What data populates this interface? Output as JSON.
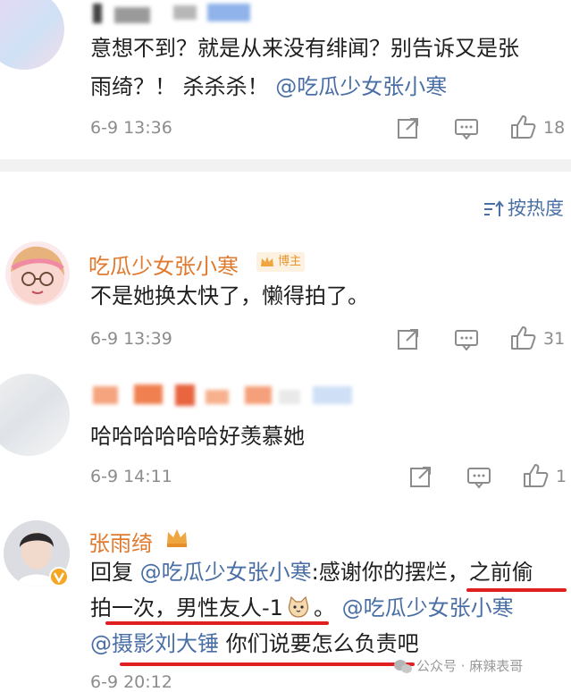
{
  "comment1": {
    "text_line1": "意想不到？就是从来没有绯闻？别告诉又是张",
    "text_line2_prefix": "雨绮？！ 杀杀杀！",
    "mention": "@吃瓜少女张小寒",
    "time": "6-9 13:36",
    "likes": "18"
  },
  "sort": {
    "label": "按热度"
  },
  "comment2": {
    "username": "吃瓜少女张小寒",
    "badge": "博主",
    "text": "不是她换太快了，懒得拍了。",
    "time": "6-9 13:39",
    "likes": "31"
  },
  "comment3": {
    "text": "哈哈哈哈哈哈好羡慕她",
    "time": "6-9 14:11",
    "likes": "1"
  },
  "comment4": {
    "username": "张雨绮",
    "line1_prefix": "回复",
    "line1_mention": "@吃瓜少女张小寒",
    "line1_suffix": ":感谢你的摆烂，之前偷",
    "line2_text": "拍一次，男性友人-1",
    "line2_suffix": "。",
    "line2_mention": "@吃瓜少女张小寒",
    "line3_mention": "@摄影刘大锤",
    "line3_text": " 你们说要怎么负责吧",
    "time": "6-9 20:12"
  },
  "watermark": "公众号 · 麻辣表哥",
  "colors": {
    "link": "#4a6fa5",
    "username": "#e07a2f",
    "underline": "#e02020",
    "meta": "#8c8c8c"
  }
}
